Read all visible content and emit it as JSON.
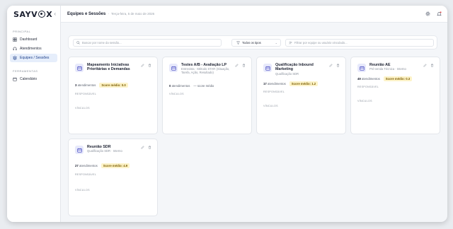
{
  "app": {
    "logo_text_left": "SAYV",
    "logo_text_right": "X",
    "brand_color": "#1b2030",
    "accent_color": "#1d3f8a"
  },
  "sidebar": {
    "sections": [
      {
        "label": "PRINCIPAL"
      },
      {
        "label": "FERRAMENTAS"
      }
    ],
    "items": [
      {
        "label": "Dashboard",
        "icon": "dashboard-icon"
      },
      {
        "label": "Atendimentos",
        "icon": "headset-icon"
      },
      {
        "label": "Equipes / Sessões",
        "icon": "layers-icon",
        "active": true
      },
      {
        "label": "Calendário",
        "icon": "calendar-icon"
      }
    ]
  },
  "topbar": {
    "title": "Equipes e Sessões",
    "separator": "·",
    "date": "Terça-feira, 5 de maio de 2026"
  },
  "filters": {
    "search_placeholder": "Buscar por nome da sessão...",
    "type_value": "Todos os tipos",
    "user_placeholder": "Filtrar por equipe ou usuário vinculado..."
  },
  "cards": [
    {
      "title": "Mapeamento Iniciativas Prioritárias e Demandas",
      "subtitle": "",
      "count": "3",
      "count_label": "atendimentos",
      "score": "Score médio: 0.0",
      "responsavel_label": "RESPONSÁVEL",
      "vinculos_label": "VÍNCULOS"
    },
    {
      "title": "Testes A/B - Avaliação LP",
      "subtitle": "Entrevista · Método STAR (Situação, Tarefa, Ação, Resultado)",
      "count": "0",
      "count_label": "atendimentos",
      "score": "— score médio",
      "responsavel_label": "",
      "vinculos_label": "VÍNCULOS"
    },
    {
      "title": "Qualificação Inbound Marketing",
      "subtitle": "Qualificação SDR",
      "count": "17",
      "count_label": "atendimentos",
      "score": "Score médio: 1.2",
      "responsavel_label": "RESPONSÁVEL",
      "vinculos_label": "VÍNCULOS"
    },
    {
      "title": "Reunião AE",
      "subtitle": "Pré-venda Técnica · Interno",
      "count": "49",
      "count_label": "atendimentos",
      "score": "Score médio: 0.3",
      "responsavel_label": "RESPONSÁVEL",
      "vinculos_label": "VÍNCULOS"
    },
    {
      "title": "Reunião SDR",
      "subtitle": "Qualificação SDR · Interno",
      "count": "27",
      "count_label": "atendimentos",
      "score": "Score médio: 4.9",
      "responsavel_label": "RESPONSÁVEL",
      "vinculos_label": "VÍNCULOS"
    }
  ]
}
